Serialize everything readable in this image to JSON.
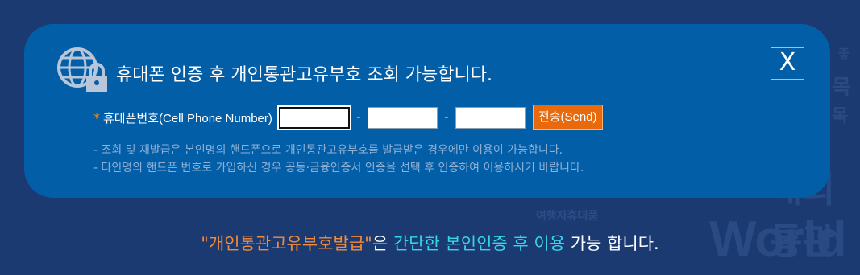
{
  "background": {
    "world": "World",
    "kr1": "해외통관",
    "kr2": "여행자휴대품",
    "kr3": "목",
    "kr4": "목",
    "kr5": "좋"
  },
  "dialog": {
    "title": "휴대폰 인증 후 개인통관고유부호 조회 가능합니다.",
    "close_label": "X",
    "icon": "globe-lock-icon",
    "phone": {
      "required_mark": "*",
      "label": "휴대폰번호(Cell Phone Number)",
      "part1": "",
      "part2": "",
      "part3": "",
      "separator": "-",
      "send_label": "전송(Send)"
    },
    "notes": [
      "- 조회 및 재발급은 본인명의 핸드폰으로 개인통관고유부호를 발급받은 경우에만 이용이 가능합니다.",
      "- 타인명의 핸드폰 번호로 가입하신 경우 공동·금융인증서 인증을 선택 후 인증하여 이용하시기 바랍니다."
    ]
  },
  "tagline": {
    "part1": "\"개인통관고유부호발급\"",
    "part2": "은 ",
    "part3": "간단한 본인인증 후 이용",
    "part4": " 가능 합니다."
  },
  "colors": {
    "page_bg": "#1b3a72",
    "panel_bg": "#035ea8",
    "accent_orange": "#e86a0c",
    "accent_cyan": "#36d6e8"
  }
}
